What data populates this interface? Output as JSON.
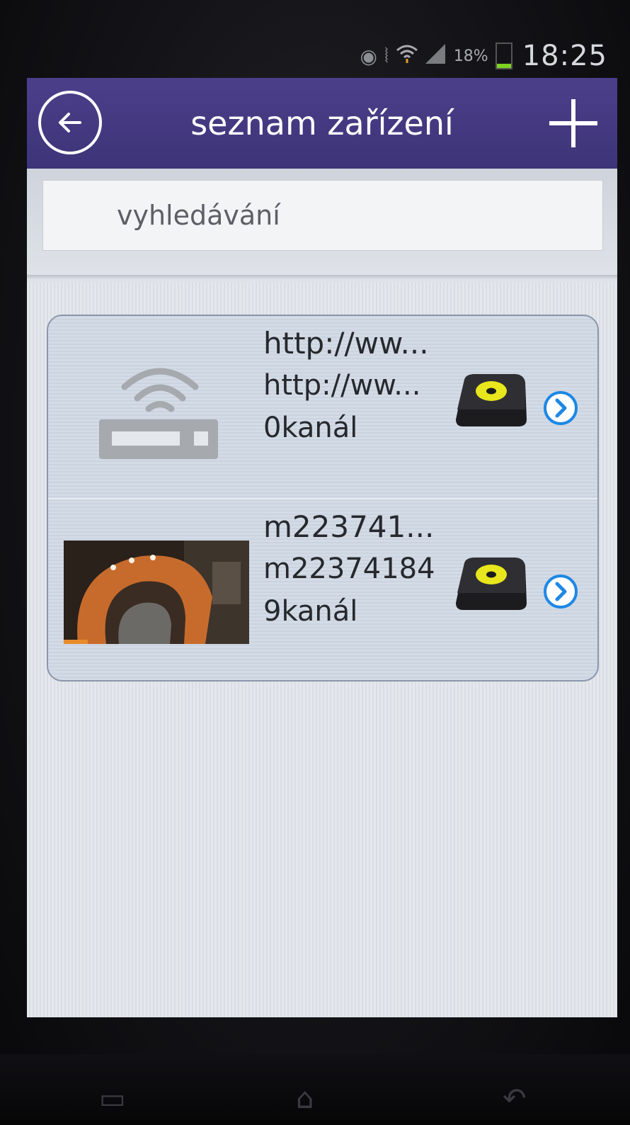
{
  "status_bar": {
    "battery_pct": "18%",
    "time": "18:25",
    "icons": [
      "eye-icon",
      "vibrate-icon",
      "wifi-icon",
      "signal-icon",
      "battery-icon"
    ]
  },
  "header": {
    "title": "seznam zařízení",
    "back_icon": "arrow-left-circle-icon",
    "add_icon": "plus-icon"
  },
  "search": {
    "placeholder": "vyhledávání"
  },
  "devices": [
    {
      "thumbnail": "router-icon",
      "line1": "http://ww...",
      "line2": "http://ww...",
      "channels": "0kanál",
      "type_icon": "dvr-device-icon",
      "action_icon": "chevron-right-circle-icon"
    },
    {
      "thumbnail": "camera-preview",
      "line1": "m223741...",
      "line2": "m22374184",
      "channels": "9kanál",
      "type_icon": "dvr-device-icon",
      "action_icon": "chevron-right-circle-icon"
    }
  ],
  "colors": {
    "titlebar": "#3e3478",
    "accent_blue": "#1e88e5",
    "dvr_dot": "#e8e61c"
  }
}
